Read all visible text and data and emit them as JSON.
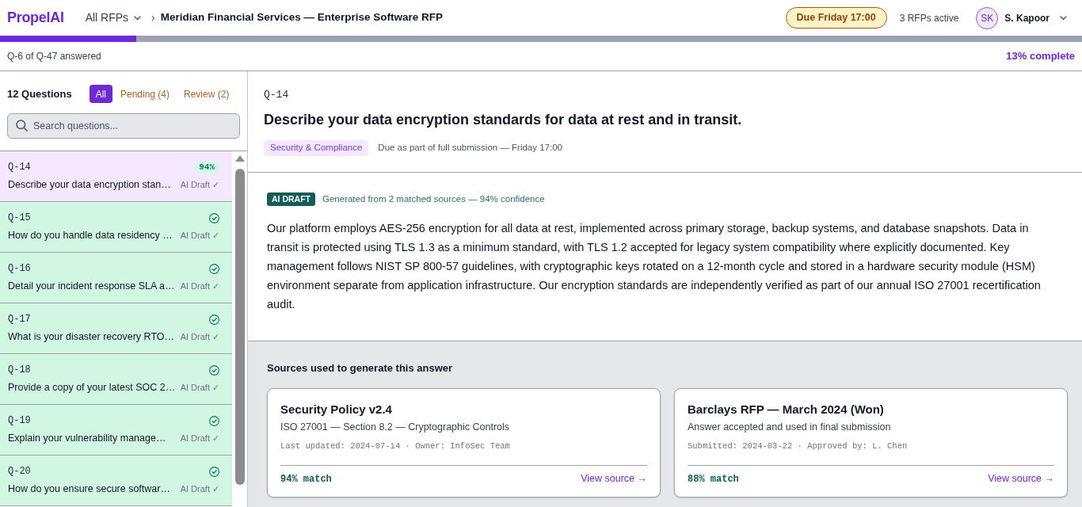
{
  "app": {
    "logo": "PropelAI",
    "breadcrumb": {
      "parent": "All RFPs",
      "separator": "›",
      "current": "Meridian Financial Services — Enterprise Software RFP"
    },
    "due_badge": "Due Friday 17:00",
    "active_count": "3 RFPs active",
    "user": {
      "initials": "SK",
      "name": "S. Kapoor"
    }
  },
  "progress": {
    "level": 0.126,
    "answered": "Q-6 of Q-47 answered",
    "percent": "13% complete"
  },
  "sidebar": {
    "title": "12 Questions",
    "filters": [
      {
        "label": "All",
        "selected": true
      },
      {
        "label": "Pending (4)",
        "selected": false
      },
      {
        "label": "Review (2)",
        "selected": false
      }
    ],
    "search": {
      "placeholder": "Search questions..."
    },
    "questions": [
      {
        "id": "Q-14",
        "text": "Describe your data encryption stan…",
        "status": "AI Draft ✓",
        "kind": "score",
        "score": "94%",
        "selected": true
      },
      {
        "id": "Q-15",
        "text": "How do you handle data residency …",
        "status": "AI Draft ✓",
        "kind": "done",
        "selected": false
      },
      {
        "id": "Q-16",
        "text": "Detail your incident response SLA a…",
        "status": "AI Draft ✓",
        "kind": "done",
        "selected": false
      },
      {
        "id": "Q-17",
        "text": "What is your disaster recovery RTO…",
        "status": "AI Draft ✓",
        "kind": "done",
        "selected": false
      },
      {
        "id": "Q-18",
        "text": "Provide a copy of your latest SOC 2…",
        "status": "AI Draft ✓",
        "kind": "done",
        "selected": false
      },
      {
        "id": "Q-19",
        "text": "Explain your vulnerability manage…",
        "status": "AI Draft ✓",
        "kind": "done",
        "selected": false
      },
      {
        "id": "Q-20",
        "text": "How do you ensure secure softwar…",
        "status": "AI Draft ✓",
        "kind": "done",
        "selected": false
      }
    ]
  },
  "question": {
    "id": "Q-14",
    "title": "Describe your data encryption standards for data at rest and in transit.",
    "category": "Security & Compliance",
    "due": "Due as part of full submission — Friday 17:00"
  },
  "answer": {
    "badge": "AI DRAFT",
    "meta": "Generated from 2 matched sources — 94% confidence",
    "text": "Our platform employs AES-256 encryption for all data at rest, implemented across primary storage, backup systems, and database snapshots. Data in transit is protected using TLS 1.3 as a minimum standard, with TLS 1.2 accepted for legacy system compatibility where explicitly documented. Key management follows NIST SP 800-57 guidelines, with cryptographic keys rotated on a 12-month cycle and stored in a hardware security module (HSM) environment separate from application infrastructure. Our encryption standards are independently verified as part of our annual ISO 27001 recertification audit."
  },
  "sources": {
    "title": "Sources used to generate this answer",
    "cards": [
      {
        "title": "Security Policy v2.4",
        "subtitle": "ISO 27001 — Section 8.2 — Cryptographic Controls",
        "meta": "Last updated: 2024-07-14 · Owner: InfoSec Team",
        "match": "94% match",
        "link": "View source →"
      },
      {
        "title": "Barclays RFP — March 2024 (Won)",
        "subtitle": "Answer accepted and used in final submission",
        "meta": "Submitted: 2024-03-22 · Approved by: L. Chen",
        "match": "88% match",
        "link": "View source →"
      }
    ]
  }
}
